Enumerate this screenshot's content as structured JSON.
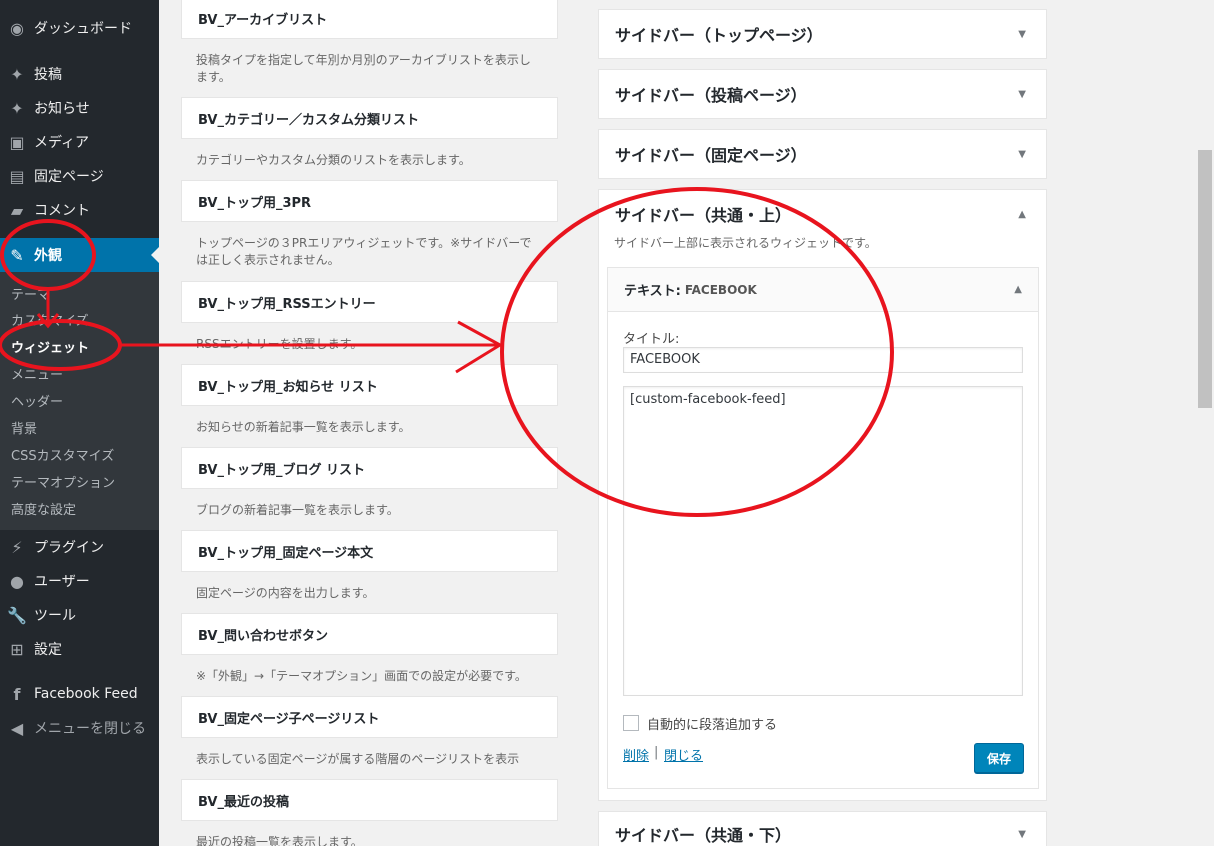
{
  "sidebar": {
    "items": [
      {
        "label": "ダッシュボード",
        "icon": "dashboard-icon"
      },
      {
        "label": "投稿",
        "icon": "pin-icon"
      },
      {
        "label": "お知らせ",
        "icon": "pin-icon"
      },
      {
        "label": "メディア",
        "icon": "media-icon"
      },
      {
        "label": "固定ページ",
        "icon": "page-icon"
      },
      {
        "label": "コメント",
        "icon": "comment-icon"
      },
      {
        "label": "外観",
        "icon": "brush-icon"
      },
      {
        "label": "プラグイン",
        "icon": "plugin-icon"
      },
      {
        "label": "ユーザー",
        "icon": "user-icon"
      },
      {
        "label": "ツール",
        "icon": "wrench-icon"
      },
      {
        "label": "設定",
        "icon": "settings-icon"
      },
      {
        "label": "Facebook Feed",
        "icon": "facebook-icon"
      },
      {
        "label": "メニューを閉じる",
        "icon": "collapse-icon"
      }
    ],
    "submenu": [
      "テーマ",
      "カスタマイズ",
      "ウィジェット",
      "メニュー",
      "ヘッダー",
      "背景",
      "CSSカスタマイズ",
      "テーマオプション",
      "高度な設定"
    ]
  },
  "available_widgets": [
    {
      "title": "BV_アーカイブリスト",
      "desc": [
        "投稿タイプを指定して年別か月別のアーカイブリストを表示し",
        "ます。"
      ]
    },
    {
      "title": "BV_カテゴリー／カスタム分類リスト",
      "desc": [
        "カテゴリーやカスタム分類のリストを表示します。"
      ]
    },
    {
      "title": "BV_トップ用_3PR",
      "desc": [
        "トップページの３PRエリアウィジェットです。※サイドバーで",
        "は正しく表示されません。"
      ]
    },
    {
      "title": "BV_トップ用_RSSエントリー",
      "desc": [
        "RSSエントリーを設置します。"
      ]
    },
    {
      "title": "BV_トップ用_お知らせ リスト",
      "desc": [
        "お知らせの新着記事一覧を表示します。"
      ]
    },
    {
      "title": "BV_トップ用_ブログ リスト",
      "desc": [
        "ブログの新着記事一覧を表示します。"
      ]
    },
    {
      "title": "BV_トップ用_固定ページ本文",
      "desc": [
        "固定ページの内容を出力します。"
      ]
    },
    {
      "title": "BV_問い合わせボタン",
      "desc": [
        "※「外観」→「テーマオプション」画面での設定が必要です。"
      ]
    },
    {
      "title": "BV_固定ページ子ページリスト",
      "desc": [
        "表示している固定ページが属する階層のページリストを表示"
      ]
    },
    {
      "title": "BV_最近の投稿",
      "desc": [
        "最近の投稿一覧を表示します。"
      ]
    }
  ],
  "sidebars": [
    {
      "title": "サイドバー（トップページ）",
      "arrow": "▼"
    },
    {
      "title": "サイドバー（投稿ページ）",
      "arrow": "▼"
    },
    {
      "title": "サイドバー（固定ページ）",
      "arrow": "▼"
    },
    {
      "title": "サイドバー（共通・上）",
      "arrow": "▲",
      "desc": "サイドバー上部に表示されるウィジェットです。"
    },
    {
      "title": "サイドバー（共通・下）",
      "arrow": "▼"
    }
  ],
  "widget": {
    "head_prefix": "テキスト:",
    "head_name": "FACEBOOK",
    "arrow": "▲",
    "title_label": "タイトル:",
    "title_value": "FACEBOOK",
    "content_value": "[custom-facebook-feed]",
    "auto_paragraph_label": "自動的に段落追加する",
    "delete_label": "削除",
    "separator": "|",
    "close_label": "閉じる",
    "save_label": "保存"
  },
  "colors": {
    "admin_bar": "#23282d",
    "accent": "#0073aa",
    "annotation": "#e8141e"
  }
}
